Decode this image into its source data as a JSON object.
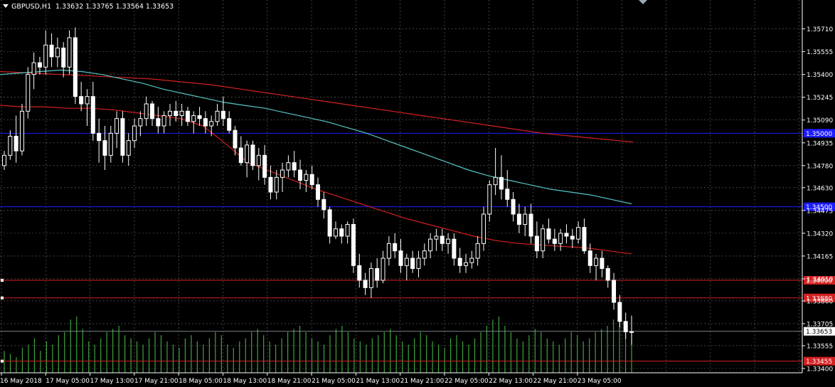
{
  "header": {
    "symbol": "GBPUSD,H1",
    "ohlc": "1.33632 1.33765 1.33564 1.33653"
  },
  "colors": {
    "background": "#000000",
    "grid": "#6b6b6b",
    "axis": "#ffffff",
    "candle": "#ffffff",
    "volume": "#3fa33f",
    "ma_fast": "#56c5c5",
    "ma_slow": "#d42020",
    "level_blue": "#1c1cff",
    "level_red": "#d42020",
    "price_line": "#9aa7b3"
  },
  "chart_data": {
    "type": "candlestick",
    "symbol": "GBPUSD",
    "timeframe": "H1",
    "ylim": [
      1.334,
      1.358
    ],
    "yticks": [
      "1.35710",
      "1.35555",
      "1.35400",
      "1.35245",
      "1.35090",
      "1.34935",
      "1.34780",
      "1.34630",
      "1.34475",
      "1.34320",
      "1.34165",
      "1.34010",
      "1.33860",
      "1.33705",
      "1.33555",
      "1.33400"
    ],
    "xticks": [
      "16 May 2018",
      "17 May 05:00",
      "17 May 13:00",
      "17 May 21:00",
      "18 May 05:00",
      "18 May 13:00",
      "18 May 21:00",
      "21 May 05:00",
      "21 May 13:00",
      "21 May 21:00",
      "22 May 05:00",
      "22 May 13:00",
      "22 May 21:00",
      "23 May 05:00"
    ],
    "grid": true,
    "candles": [
      [
        1.3478,
        1.3488,
        1.3475,
        1.3485
      ],
      [
        1.3485,
        1.3502,
        1.3482,
        1.3498
      ],
      [
        1.3498,
        1.3512,
        1.348,
        1.3488
      ],
      [
        1.3488,
        1.352,
        1.3485,
        1.3515
      ],
      [
        1.3515,
        1.3545,
        1.351,
        1.354
      ],
      [
        1.354,
        1.3555,
        1.353,
        1.3548
      ],
      [
        1.3548,
        1.3552,
        1.354,
        1.3545
      ],
      [
        1.3545,
        1.357,
        1.354,
        1.356
      ],
      [
        1.356,
        1.3568,
        1.3545,
        1.3552
      ],
      [
        1.3552,
        1.3565,
        1.3545,
        1.3558
      ],
      [
        1.3558,
        1.3562,
        1.3538,
        1.3545
      ],
      [
        1.3545,
        1.357,
        1.354,
        1.3565
      ],
      [
        1.3565,
        1.3572,
        1.352,
        1.3525
      ],
      [
        1.3525,
        1.3535,
        1.3515,
        1.352
      ],
      [
        1.352,
        1.353,
        1.3505,
        1.3525
      ],
      [
        1.3525,
        1.3535,
        1.3495,
        1.35
      ],
      [
        1.35,
        1.351,
        1.348,
        1.3495
      ],
      [
        1.3495,
        1.3505,
        1.3475,
        1.3485
      ],
      [
        1.3485,
        1.3505,
        1.348,
        1.35
      ],
      [
        1.35,
        1.3515,
        1.349,
        1.351
      ],
      [
        1.351,
        1.3515,
        1.348,
        1.3485
      ],
      [
        1.3485,
        1.35,
        1.3478,
        1.3495
      ],
      [
        1.3495,
        1.351,
        1.349,
        1.3505
      ],
      [
        1.3505,
        1.3515,
        1.3498,
        1.351
      ],
      [
        1.351,
        1.3525,
        1.3505,
        1.352
      ],
      [
        1.352,
        1.3522,
        1.3505,
        1.351
      ],
      [
        1.351,
        1.3518,
        1.35,
        1.3505
      ],
      [
        1.3505,
        1.3515,
        1.35,
        1.3512
      ],
      [
        1.3512,
        1.352,
        1.3505,
        1.3515
      ],
      [
        1.3515,
        1.3522,
        1.3508,
        1.3512
      ],
      [
        1.3512,
        1.352,
        1.3505,
        1.3515
      ],
      [
        1.3515,
        1.3518,
        1.3505,
        1.3508
      ],
      [
        1.3508,
        1.3515,
        1.35,
        1.3512
      ],
      [
        1.3512,
        1.3518,
        1.3505,
        1.351
      ],
      [
        1.351,
        1.3515,
        1.35,
        1.3505
      ],
      [
        1.3505,
        1.3512,
        1.3498,
        1.3508
      ],
      [
        1.3508,
        1.352,
        1.3505,
        1.3515
      ],
      [
        1.3515,
        1.3525,
        1.3505,
        1.351
      ],
      [
        1.351,
        1.3515,
        1.35,
        1.3502
      ],
      [
        1.3502,
        1.3505,
        1.3485,
        1.349
      ],
      [
        1.349,
        1.3498,
        1.3478,
        1.348
      ],
      [
        1.348,
        1.3495,
        1.347,
        1.3492
      ],
      [
        1.3492,
        1.3495,
        1.3475,
        1.3478
      ],
      [
        1.3478,
        1.349,
        1.3468,
        1.3485
      ],
      [
        1.3485,
        1.3492,
        1.3465,
        1.347
      ],
      [
        1.347,
        1.3478,
        1.3455,
        1.346
      ],
      [
        1.346,
        1.3475,
        1.3455,
        1.347
      ],
      [
        1.347,
        1.348,
        1.346,
        1.3475
      ],
      [
        1.3475,
        1.3485,
        1.347,
        1.348
      ],
      [
        1.348,
        1.3488,
        1.347,
        1.3475
      ],
      [
        1.3475,
        1.3482,
        1.3462,
        1.3468
      ],
      [
        1.3468,
        1.3475,
        1.346,
        1.3472
      ],
      [
        1.3472,
        1.3478,
        1.3462,
        1.3465
      ],
      [
        1.3465,
        1.347,
        1.345,
        1.3455
      ],
      [
        1.3455,
        1.346,
        1.3442,
        1.3448
      ],
      [
        1.3448,
        1.345,
        1.3425,
        1.343
      ],
      [
        1.343,
        1.344,
        1.3428,
        1.3435
      ],
      [
        1.3435,
        1.3438,
        1.3425,
        1.343
      ],
      [
        1.343,
        1.344,
        1.3425,
        1.3438
      ],
      [
        1.3438,
        1.3442,
        1.3405,
        1.341
      ],
      [
        1.341,
        1.3418,
        1.3395,
        1.34
      ],
      [
        1.34,
        1.3405,
        1.339,
        1.3395
      ],
      [
        1.3395,
        1.3412,
        1.3388,
        1.3408
      ],
      [
        1.3408,
        1.3415,
        1.3395,
        1.34
      ],
      [
        1.34,
        1.342,
        1.3398,
        1.3415
      ],
      [
        1.3415,
        1.343,
        1.341,
        1.3425
      ],
      [
        1.3425,
        1.3432,
        1.3415,
        1.342
      ],
      [
        1.342,
        1.3428,
        1.3405,
        1.341
      ],
      [
        1.341,
        1.3418,
        1.34,
        1.3415
      ],
      [
        1.3415,
        1.342,
        1.3405,
        1.3408
      ],
      [
        1.3408,
        1.342,
        1.3402,
        1.3415
      ],
      [
        1.3415,
        1.3425,
        1.341,
        1.342
      ],
      [
        1.342,
        1.3432,
        1.3415,
        1.3428
      ],
      [
        1.3428,
        1.3435,
        1.342,
        1.343
      ],
      [
        1.343,
        1.3435,
        1.342,
        1.3425
      ],
      [
        1.3425,
        1.3432,
        1.3418,
        1.3428
      ],
      [
        1.3428,
        1.3432,
        1.341,
        1.3415
      ],
      [
        1.3415,
        1.3422,
        1.3405,
        1.341
      ],
      [
        1.341,
        1.3418,
        1.3405,
        1.3412
      ],
      [
        1.3412,
        1.342,
        1.3408,
        1.3415
      ],
      [
        1.3415,
        1.343,
        1.341,
        1.3425
      ],
      [
        1.3425,
        1.345,
        1.342,
        1.3445
      ],
      [
        1.3445,
        1.3468,
        1.344,
        1.3465
      ],
      [
        1.3465,
        1.349,
        1.3458,
        1.347
      ],
      [
        1.347,
        1.3485,
        1.3455,
        1.3462
      ],
      [
        1.3462,
        1.3475,
        1.345,
        1.3455
      ],
      [
        1.3455,
        1.346,
        1.344,
        1.3445
      ],
      [
        1.3445,
        1.3452,
        1.3432,
        1.3438
      ],
      [
        1.3438,
        1.345,
        1.343,
        1.3445
      ],
      [
        1.3445,
        1.3452,
        1.3425,
        1.343
      ],
      [
        1.343,
        1.344,
        1.3415,
        1.342
      ],
      [
        1.342,
        1.3438,
        1.3415,
        1.3435
      ],
      [
        1.3435,
        1.3442,
        1.3425,
        1.3428
      ],
      [
        1.3428,
        1.3435,
        1.342,
        1.3425
      ],
      [
        1.3425,
        1.3435,
        1.342,
        1.3432
      ],
      [
        1.3432,
        1.3438,
        1.3425,
        1.343
      ],
      [
        1.343,
        1.3435,
        1.3422,
        1.3428
      ],
      [
        1.3428,
        1.344,
        1.3425,
        1.3436
      ],
      [
        1.3436,
        1.3442,
        1.3418,
        1.342
      ],
      [
        1.342,
        1.3425,
        1.3405,
        1.341
      ],
      [
        1.341,
        1.3418,
        1.34,
        1.3415
      ],
      [
        1.3415,
        1.342,
        1.3402,
        1.3408
      ],
      [
        1.3408,
        1.341,
        1.3395,
        1.34
      ],
      [
        1.34,
        1.3405,
        1.338,
        1.3385
      ],
      [
        1.3385,
        1.339,
        1.3368,
        1.3372
      ],
      [
        1.3372,
        1.3378,
        1.336,
        1.3365
      ],
      [
        1.3365,
        1.3376,
        1.3356,
        1.3365
      ]
    ],
    "ma_fast": [
      1.354,
      1.3541,
      1.3542,
      1.3543,
      1.3542,
      1.354,
      1.3537,
      1.3534,
      1.353,
      1.3527,
      1.3524,
      1.3521,
      1.3519,
      1.3517,
      1.3514,
      1.3511,
      1.3508,
      1.3504,
      1.35,
      1.3495,
      1.349,
      1.3485,
      1.348,
      1.3475,
      1.3471,
      1.3468,
      1.3465,
      1.3462,
      1.346,
      1.3458,
      1.3455,
      1.3452
    ],
    "ma_slow": [
      1.3519,
      1.3518,
      1.3518,
      1.3517,
      1.3517,
      1.3516,
      1.3514,
      1.3512,
      1.351,
      1.3505,
      1.3493,
      1.348,
      1.3474,
      1.3468,
      1.3462,
      1.3457,
      1.3452,
      1.3447,
      1.3442,
      1.3438,
      1.3434,
      1.343,
      1.3427,
      1.3425,
      1.3424,
      1.3423,
      1.3422,
      1.342,
      1.3418
    ],
    "ma_red_upper": [
      1.3542,
      1.3541,
      1.354,
      1.3539,
      1.3538,
      1.3537,
      1.3535,
      1.3533,
      1.353,
      1.3527,
      1.3524,
      1.3521,
      1.3518,
      1.3515,
      1.3512,
      1.3509,
      1.3506,
      1.3503,
      1.35,
      1.3498,
      1.3496,
      1.3494
    ],
    "levels": [
      {
        "price": 1.35,
        "label": "1.35000",
        "color": "blue"
      },
      {
        "price": 1.345,
        "label": "1.34500",
        "color": "blue"
      },
      {
        "price": 1.34,
        "label": "1.34000",
        "color": "red"
      },
      {
        "price": 1.3388,
        "label": "1.33880",
        "color": "red"
      },
      {
        "price": 1.3345,
        "label": "1.33455",
        "color": "red"
      }
    ],
    "last_price": {
      "price": 1.33653,
      "label": "1.33653"
    },
    "volumes": [
      14,
      12,
      10,
      16,
      18,
      22,
      14,
      20,
      18,
      24,
      26,
      34,
      36,
      28,
      20,
      18,
      22,
      26,
      28,
      30,
      24,
      22,
      20,
      18,
      22,
      26,
      24,
      20,
      18,
      16,
      22,
      24,
      20,
      18,
      22,
      26,
      24,
      18,
      16,
      20,
      22,
      26,
      28,
      24,
      20,
      18,
      22,
      26,
      28,
      30,
      26,
      22,
      20,
      18,
      24,
      28,
      30,
      26,
      22,
      20,
      18,
      22,
      24,
      26,
      28,
      24,
      20,
      18,
      22,
      26,
      24,
      20,
      18,
      16,
      22,
      24,
      20,
      18,
      22,
      26,
      30,
      34,
      36,
      30,
      26,
      22,
      20,
      24,
      28,
      26,
      22,
      20,
      18,
      22,
      26,
      24,
      20,
      22,
      26,
      28,
      30,
      34,
      32,
      28,
      26
    ]
  }
}
